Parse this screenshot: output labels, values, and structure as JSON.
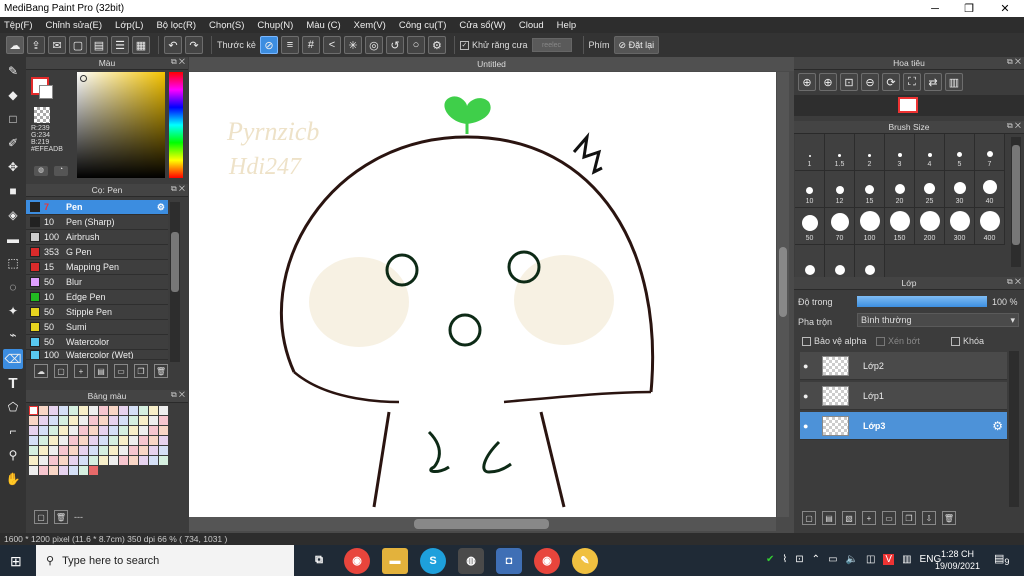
{
  "window": {
    "title": "MediBang Paint Pro (32bit)",
    "minimize": "─",
    "maximize": "❐",
    "close": "✕"
  },
  "menu": [
    "Tệp(F)",
    "Chỉnh sửa(E)",
    "Lớp(L)",
    "Bộ lọc(R)",
    "Chọn(S)",
    "Chụp(N)",
    "Màu (C)",
    "Xem(V)",
    "Công cụ(T)",
    "Cửa sổ(W)",
    "Cloud",
    "Help"
  ],
  "toolbar": {
    "ruler_label": "Thước kẻ",
    "antialias_label": "Khử răng cưa",
    "disabled_field": "reelec",
    "key_label": "Phím",
    "reset_label": "Đặt lại"
  },
  "color_panel": {
    "title": "Màu",
    "r": "R:239",
    "g": "G:234",
    "b": "B:219",
    "hex": "#EFEADB",
    "fg": "#e32a2a",
    "bg": "#ffffff"
  },
  "brush_panel": {
    "title": "Cọ: Pen",
    "items": [
      {
        "size": "7",
        "name": "Pen",
        "color": "#222222"
      },
      {
        "size": "10",
        "name": "Pen (Sharp)",
        "color": "#222222"
      },
      {
        "size": "100",
        "name": "Airbrush",
        "color": "#cccccc"
      },
      {
        "size": "353",
        "name": "G Pen",
        "color": "#d92b2b"
      },
      {
        "size": "15",
        "name": "Mapping Pen",
        "color": "#d92b2b"
      },
      {
        "size": "50",
        "name": "Blur",
        "color": "#e0a0ff"
      },
      {
        "size": "10",
        "name": "Edge Pen",
        "color": "#22bb22"
      },
      {
        "size": "50",
        "name": "Stipple Pen",
        "color": "#e6d31f"
      },
      {
        "size": "50",
        "name": "Sumi",
        "color": "#e6d31f"
      },
      {
        "size": "50",
        "name": "Watercolor",
        "color": "#58c8f0"
      },
      {
        "size": "100",
        "name": "Watercolor (Wet)",
        "color": "#58c8f0"
      }
    ]
  },
  "palette_panel": {
    "title": "Bảng màu",
    "footer": "---"
  },
  "canvas": {
    "tab": "Untitled",
    "note1": "Pyrnzicb",
    "note2": "Hdi247"
  },
  "navigator": {
    "title": "Hoa tiêu"
  },
  "brush_size": {
    "title": "Brush Size",
    "sizes": [
      "1",
      "1.5",
      "2",
      "3",
      "4",
      "5",
      "7",
      "10",
      "12",
      "15",
      "20",
      "25",
      "30",
      "40",
      "50",
      "70",
      "100",
      "150",
      "200",
      "300",
      "400",
      "",
      "",
      ""
    ]
  },
  "layer_panel": {
    "title": "Lớp",
    "opacity_label": "Độ trong",
    "opacity_value": "100 %",
    "opacity": 1.0,
    "blend_label": "Pha trộn",
    "blend_value": "Bình thường",
    "protect_alpha": "Bảo vệ alpha",
    "clipping": "Xén bớt",
    "lock": "Khóa",
    "layers": [
      {
        "name": "Lớp2",
        "selected": false
      },
      {
        "name": "Lớp1",
        "selected": false
      },
      {
        "name": "Lớp3",
        "selected": true
      }
    ]
  },
  "status": {
    "text": "1600 * 1200 pixel   (11.6 * 8.7cm)   350 dpi   66 %   ( 734, 1031 )"
  },
  "taskbar": {
    "search_placeholder": "Type here to search",
    "time": "1:28 CH",
    "date": "19/09/2021",
    "lang": "ENG",
    "notif": "9"
  }
}
